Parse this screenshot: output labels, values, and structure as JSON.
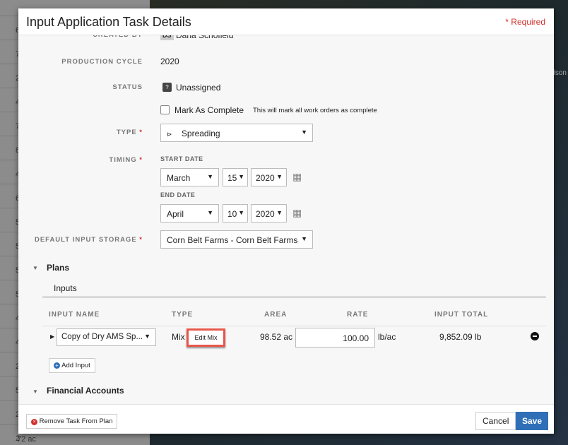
{
  "background": {
    "list_values": [
      "6",
      "7",
      "2",
      "4",
      "7",
      "8",
      "4",
      "6",
      "5",
      "5",
      "5",
      "5",
      "4",
      "4",
      "2",
      "5",
      "2",
      "2"
    ],
    "footer_area": "72 ac",
    "map_label": "dson"
  },
  "modal": {
    "title": "Input Application Task Details",
    "required_note": "* Required",
    "created_by": {
      "label": "CREATED BY",
      "initials": "DS",
      "name": "Dana Schofield"
    },
    "production_cycle": {
      "label": "PRODUCTION CYCLE",
      "value": "2020"
    },
    "status": {
      "label": "STATUS",
      "icon": "question-icon",
      "icon_text": "?",
      "value": "Unassigned"
    },
    "mark_complete": {
      "label": "Mark As Complete",
      "hint": "This will mark all work orders as complete",
      "checked": false
    },
    "type": {
      "label": "TYPE",
      "value": "Spreading",
      "icon": "spreader-icon"
    },
    "timing": {
      "label": "TIMING",
      "start_label": "START DATE",
      "start": {
        "month": "March",
        "day": "15",
        "year": "2020"
      },
      "end_label": "END DATE",
      "end": {
        "month": "April",
        "day": "10",
        "year": "2020"
      }
    },
    "storage": {
      "label": "DEFAULT INPUT STORAGE",
      "value": "Corn Belt Farms - Corn Belt Farms"
    },
    "plans": {
      "label": "Plans",
      "tab": "Inputs",
      "headers": {
        "name": "INPUT NAME",
        "type": "TYPE",
        "area": "AREA",
        "rate": "RATE",
        "total": "INPUT TOTAL"
      },
      "rows": [
        {
          "name": "Copy of Dry AMS Sp...",
          "type": "Mix",
          "edit": "Edit Mix",
          "area": "98.52 ac",
          "rate": "100.00",
          "unit": "lb/ac",
          "total": "9,852.09 lb"
        }
      ],
      "add": "Add Input"
    },
    "financial": {
      "label": "Financial Accounts"
    },
    "footer": {
      "remove": "Remove Task From Plan",
      "cancel": "Cancel",
      "save": "Save"
    },
    "colors": {
      "accent": "#2f6fb8",
      "required": "#d0312d",
      "highlight": "#e8574a"
    }
  }
}
